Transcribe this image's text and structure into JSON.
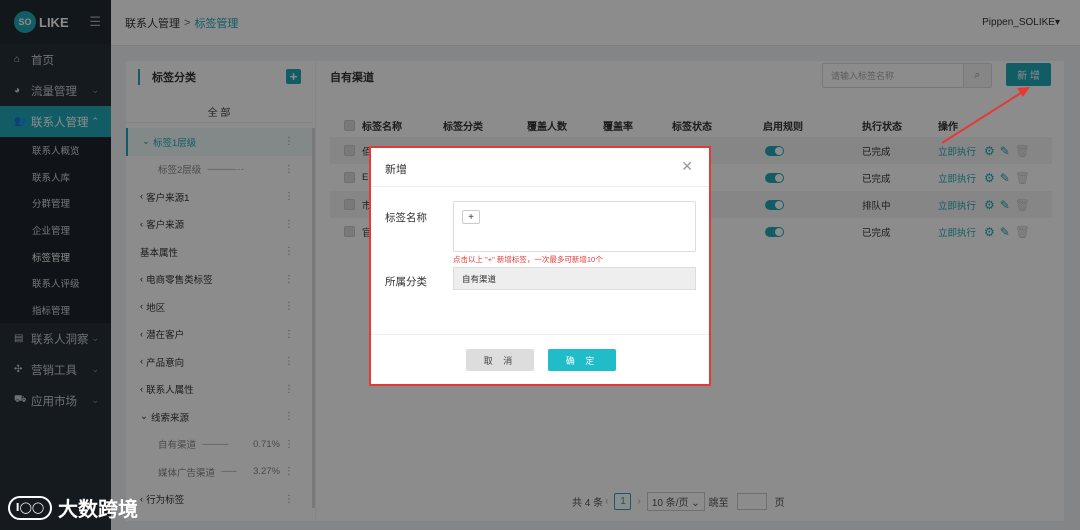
{
  "brand": {
    "logo_badge": "SO",
    "logo_text": "LIKE",
    "watermark_text": "大数跨境"
  },
  "sidebar": {
    "items": [
      {
        "label": "首页",
        "icon": "home-icon"
      },
      {
        "label": "流量管理",
        "icon": "pie-chart-icon"
      },
      {
        "label": "联系人管理",
        "icon": "users-icon",
        "active": true
      }
    ],
    "sub_items": [
      "联系人概览",
      "联系人库",
      "分群管理",
      "企业管理",
      "标签管理",
      "联系人评级",
      "指标管理"
    ],
    "bottom_items": [
      {
        "label": "联系人洞察",
        "icon": "id-card-icon"
      },
      {
        "label": "营销工具",
        "icon": "tools-icon"
      },
      {
        "label": "应用市场",
        "icon": "cart-icon"
      }
    ]
  },
  "topbar": {
    "breadcrumb_parent": "联系人管理",
    "breadcrumb_sep": ">",
    "breadcrumb_current": "标签管理",
    "user": "Pippen_SOLIKE"
  },
  "category_panel": {
    "title": "标签分类",
    "all_label": "全 部",
    "rows": [
      {
        "label": "标签1层级",
        "prefix": "⌄",
        "selected": true
      },
      {
        "label": "标签2层级",
        "level2": true,
        "dash": "------------- - -"
      },
      {
        "label": "客户来源1",
        "prefix": "‹"
      },
      {
        "label": "客户来源",
        "prefix": "‹"
      },
      {
        "label": "基本属性",
        "prefix": ""
      },
      {
        "label": "电商零售类标签",
        "prefix": "‹"
      },
      {
        "label": "地区",
        "prefix": "‹"
      },
      {
        "label": "潜在客户",
        "prefix": "‹"
      },
      {
        "label": "产品意向",
        "prefix": "‹"
      },
      {
        "label": "联系人属性",
        "prefix": "‹"
      },
      {
        "label": "线索来源",
        "prefix": "⌄"
      },
      {
        "label": "自有渠道",
        "level2": true,
        "dash": "------------",
        "pct": "0.71%"
      },
      {
        "label": "媒体广告渠道",
        "level2": true,
        "dash": "-------",
        "pct": "3.27%"
      },
      {
        "label": "行为标签",
        "prefix": "‹"
      }
    ]
  },
  "main": {
    "title": "自有渠道",
    "search_placeholder": "请输入标签名称",
    "add_button": "新 增",
    "columns": [
      "标签名称",
      "标签分类",
      "覆盖人数",
      "覆盖率",
      "标签状态",
      "启用规则",
      "执行状态",
      "操作"
    ],
    "rows": [
      {
        "name": "佰",
        "exec_status": "已完成",
        "action": "立即执行"
      },
      {
        "name": "El",
        "exec_status": "已完成",
        "action": "立即执行"
      },
      {
        "name": "市",
        "exec_status": "排队中",
        "action": "立即执行"
      },
      {
        "name": "官",
        "exec_status": "已完成",
        "action": "立即执行"
      }
    ],
    "pager": {
      "total": "共 4 条",
      "page": "1",
      "page_size": "10 条/页",
      "jump_label": "跳至",
      "page_unit": "页"
    }
  },
  "modal": {
    "title": "新增",
    "name_label": "标签名称",
    "add_symbol": "+",
    "hint": "点击以上 \"+\" 新增标签，一次最多可新增10个",
    "category_label": "所属分类",
    "category_value": "自有渠道",
    "cancel": "取 消",
    "ok": "确 定"
  },
  "colors": {
    "accent": "#20a8b8",
    "sidebar_bg": "#27303a",
    "highlight_red": "#e53935"
  }
}
